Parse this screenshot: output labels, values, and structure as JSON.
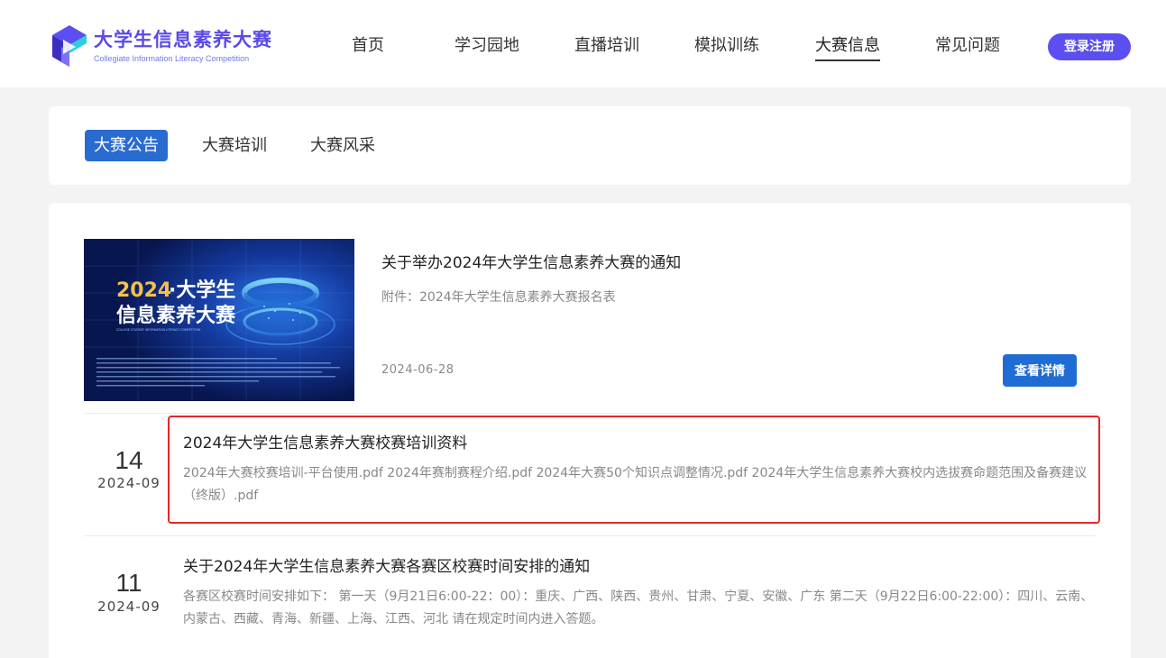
{
  "header": {
    "logo": {
      "title": "大学生信息素养大赛",
      "subtitle": "Collegiate Information Literacy Competition",
      "colors": {
        "primary": "#5b4ff0",
        "secondary": "#2ad0e0"
      }
    },
    "nav": [
      {
        "label": "首页",
        "active": false
      },
      {
        "label": "学习园地",
        "active": false
      },
      {
        "label": "直播培训",
        "active": false
      },
      {
        "label": "模拟训练",
        "active": false
      },
      {
        "label": "大赛信息",
        "active": true
      },
      {
        "label": "常见问题",
        "active": false
      }
    ],
    "login_label": "登录注册"
  },
  "tabs": [
    {
      "label": "大赛公告",
      "active": true
    },
    {
      "label": "大赛培训",
      "active": false
    },
    {
      "label": "大赛风采",
      "active": false
    }
  ],
  "featured": {
    "image": {
      "line1_year": "2024",
      "line1_rest": "·大学生",
      "line2": "信息素养大赛",
      "caption": "COLLEGE STUDENT INFORMATION LITERACY COMPETITION"
    },
    "title": "关于举办2024年大学生信息素养大赛的通知",
    "subtitle": "附件：2024年大学生信息素养大赛报名表",
    "date": "2024-06-28",
    "detail_label": "查看详情"
  },
  "items": [
    {
      "day": "14",
      "year_month": "2024-09",
      "title": "2024年大学生信息素养大赛校赛培训资料",
      "description": "2024年大赛校赛培训-平台使用.pdf 2024年赛制赛程介绍.pdf 2024年大赛50个知识点调整情况.pdf 2024年大学生信息素养大赛校内选拔赛命题范围及备赛建议（终版）.pdf",
      "highlighted": true
    },
    {
      "day": "11",
      "year_month": "2024-09",
      "title": "关于2024年大学生信息素养大赛各赛区校赛时间安排的通知",
      "description": "各赛区校赛时间安排如下： 第一天（9月21日6:00-22：00）：重庆、广西、陕西、贵州、甘肃、宁夏、安徽、广东 第二天（9月22日6:00-22:00）：四川、云南、内蒙古、西藏、青海、新疆、上海、江西、河北 请在规定时间内进入答题。",
      "highlighted": false
    }
  ],
  "colors": {
    "accent": "#2a6bd1",
    "highlight_border": "#e6262b",
    "login_button": "#5b4ff0"
  }
}
